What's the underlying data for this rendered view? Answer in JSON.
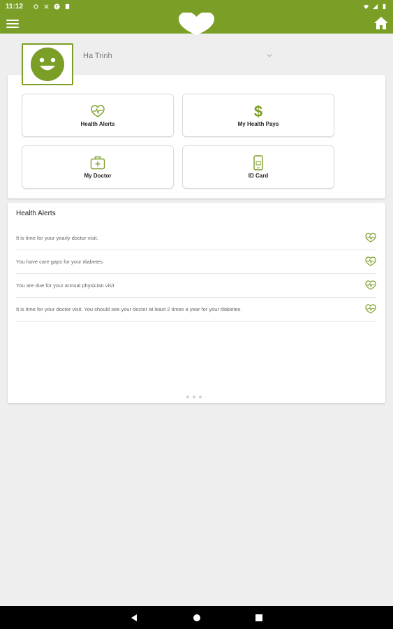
{
  "status_bar": {
    "time": "11:12"
  },
  "header": {
    "menu_icon": "hamburger-menu-icon",
    "logo_icon": "heart-logo-icon",
    "home_icon": "home-icon",
    "brand_color": "#7a9e26"
  },
  "profile": {
    "name": "Ha Trinh",
    "avatar_icon": "smiley-face-icon"
  },
  "tiles": [
    {
      "label": "Health Alerts",
      "icon": "heart-pulse-icon"
    },
    {
      "label": "My Health Pays",
      "icon": "dollar-icon"
    },
    {
      "label": "My Doctor",
      "icon": "medical-kit-icon"
    },
    {
      "label": "ID Card",
      "icon": "phone-card-icon"
    }
  ],
  "health_alerts": {
    "title": "Health Alerts",
    "items": [
      "It is time for your yearly doctor visit.",
      "You have care gaps for your diabetes",
      "You are due for your annual physician visit",
      "It is time for your doctor visit.  You should see your doctor at least 2 times a year for your diabetes."
    ]
  }
}
